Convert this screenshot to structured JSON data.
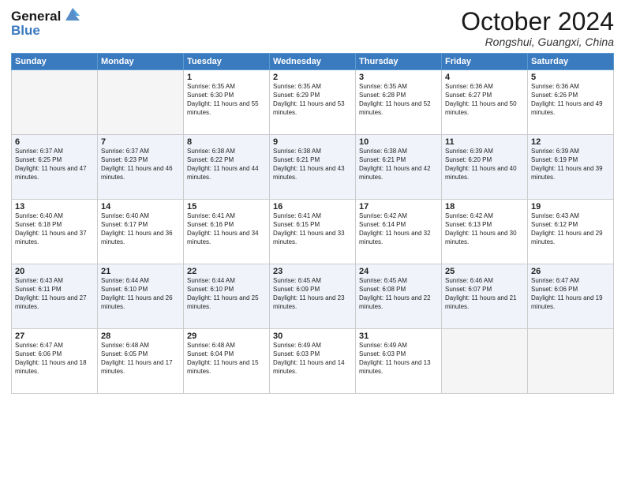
{
  "logo": {
    "line1": "General",
    "line2": "Blue"
  },
  "title": "October 2024",
  "location": "Rongshui, Guangxi, China",
  "weekdays": [
    "Sunday",
    "Monday",
    "Tuesday",
    "Wednesday",
    "Thursday",
    "Friday",
    "Saturday"
  ],
  "weeks": [
    [
      {
        "day": "",
        "sunrise": "",
        "sunset": "",
        "daylight": "",
        "empty": true
      },
      {
        "day": "",
        "sunrise": "",
        "sunset": "",
        "daylight": "",
        "empty": true
      },
      {
        "day": "1",
        "sunrise": "Sunrise: 6:35 AM",
        "sunset": "Sunset: 6:30 PM",
        "daylight": "Daylight: 11 hours and 55 minutes."
      },
      {
        "day": "2",
        "sunrise": "Sunrise: 6:35 AM",
        "sunset": "Sunset: 6:29 PM",
        "daylight": "Daylight: 11 hours and 53 minutes."
      },
      {
        "day": "3",
        "sunrise": "Sunrise: 6:35 AM",
        "sunset": "Sunset: 6:28 PM",
        "daylight": "Daylight: 11 hours and 52 minutes."
      },
      {
        "day": "4",
        "sunrise": "Sunrise: 6:36 AM",
        "sunset": "Sunset: 6:27 PM",
        "daylight": "Daylight: 11 hours and 50 minutes."
      },
      {
        "day": "5",
        "sunrise": "Sunrise: 6:36 AM",
        "sunset": "Sunset: 6:26 PM",
        "daylight": "Daylight: 11 hours and 49 minutes."
      }
    ],
    [
      {
        "day": "6",
        "sunrise": "Sunrise: 6:37 AM",
        "sunset": "Sunset: 6:25 PM",
        "daylight": "Daylight: 11 hours and 47 minutes."
      },
      {
        "day": "7",
        "sunrise": "Sunrise: 6:37 AM",
        "sunset": "Sunset: 6:23 PM",
        "daylight": "Daylight: 11 hours and 46 minutes."
      },
      {
        "day": "8",
        "sunrise": "Sunrise: 6:38 AM",
        "sunset": "Sunset: 6:22 PM",
        "daylight": "Daylight: 11 hours and 44 minutes."
      },
      {
        "day": "9",
        "sunrise": "Sunrise: 6:38 AM",
        "sunset": "Sunset: 6:21 PM",
        "daylight": "Daylight: 11 hours and 43 minutes."
      },
      {
        "day": "10",
        "sunrise": "Sunrise: 6:38 AM",
        "sunset": "Sunset: 6:21 PM",
        "daylight": "Daylight: 11 hours and 42 minutes."
      },
      {
        "day": "11",
        "sunrise": "Sunrise: 6:39 AM",
        "sunset": "Sunset: 6:20 PM",
        "daylight": "Daylight: 11 hours and 40 minutes."
      },
      {
        "day": "12",
        "sunrise": "Sunrise: 6:39 AM",
        "sunset": "Sunset: 6:19 PM",
        "daylight": "Daylight: 11 hours and 39 minutes."
      }
    ],
    [
      {
        "day": "13",
        "sunrise": "Sunrise: 6:40 AM",
        "sunset": "Sunset: 6:18 PM",
        "daylight": "Daylight: 11 hours and 37 minutes."
      },
      {
        "day": "14",
        "sunrise": "Sunrise: 6:40 AM",
        "sunset": "Sunset: 6:17 PM",
        "daylight": "Daylight: 11 hours and 36 minutes."
      },
      {
        "day": "15",
        "sunrise": "Sunrise: 6:41 AM",
        "sunset": "Sunset: 6:16 PM",
        "daylight": "Daylight: 11 hours and 34 minutes."
      },
      {
        "day": "16",
        "sunrise": "Sunrise: 6:41 AM",
        "sunset": "Sunset: 6:15 PM",
        "daylight": "Daylight: 11 hours and 33 minutes."
      },
      {
        "day": "17",
        "sunrise": "Sunrise: 6:42 AM",
        "sunset": "Sunset: 6:14 PM",
        "daylight": "Daylight: 11 hours and 32 minutes."
      },
      {
        "day": "18",
        "sunrise": "Sunrise: 6:42 AM",
        "sunset": "Sunset: 6:13 PM",
        "daylight": "Daylight: 11 hours and 30 minutes."
      },
      {
        "day": "19",
        "sunrise": "Sunrise: 6:43 AM",
        "sunset": "Sunset: 6:12 PM",
        "daylight": "Daylight: 11 hours and 29 minutes."
      }
    ],
    [
      {
        "day": "20",
        "sunrise": "Sunrise: 6:43 AM",
        "sunset": "Sunset: 6:11 PM",
        "daylight": "Daylight: 11 hours and 27 minutes."
      },
      {
        "day": "21",
        "sunrise": "Sunrise: 6:44 AM",
        "sunset": "Sunset: 6:10 PM",
        "daylight": "Daylight: 11 hours and 26 minutes."
      },
      {
        "day": "22",
        "sunrise": "Sunrise: 6:44 AM",
        "sunset": "Sunset: 6:10 PM",
        "daylight": "Daylight: 11 hours and 25 minutes."
      },
      {
        "day": "23",
        "sunrise": "Sunrise: 6:45 AM",
        "sunset": "Sunset: 6:09 PM",
        "daylight": "Daylight: 11 hours and 23 minutes."
      },
      {
        "day": "24",
        "sunrise": "Sunrise: 6:45 AM",
        "sunset": "Sunset: 6:08 PM",
        "daylight": "Daylight: 11 hours and 22 minutes."
      },
      {
        "day": "25",
        "sunrise": "Sunrise: 6:46 AM",
        "sunset": "Sunset: 6:07 PM",
        "daylight": "Daylight: 11 hours and 21 minutes."
      },
      {
        "day": "26",
        "sunrise": "Sunrise: 6:47 AM",
        "sunset": "Sunset: 6:06 PM",
        "daylight": "Daylight: 11 hours and 19 minutes."
      }
    ],
    [
      {
        "day": "27",
        "sunrise": "Sunrise: 6:47 AM",
        "sunset": "Sunset: 6:06 PM",
        "daylight": "Daylight: 11 hours and 18 minutes."
      },
      {
        "day": "28",
        "sunrise": "Sunrise: 6:48 AM",
        "sunset": "Sunset: 6:05 PM",
        "daylight": "Daylight: 11 hours and 17 minutes."
      },
      {
        "day": "29",
        "sunrise": "Sunrise: 6:48 AM",
        "sunset": "Sunset: 6:04 PM",
        "daylight": "Daylight: 11 hours and 15 minutes."
      },
      {
        "day": "30",
        "sunrise": "Sunrise: 6:49 AM",
        "sunset": "Sunset: 6:03 PM",
        "daylight": "Daylight: 11 hours and 14 minutes."
      },
      {
        "day": "31",
        "sunrise": "Sunrise: 6:49 AM",
        "sunset": "Sunset: 6:03 PM",
        "daylight": "Daylight: 11 hours and 13 minutes."
      },
      {
        "day": "",
        "sunrise": "",
        "sunset": "",
        "daylight": "",
        "empty": true
      },
      {
        "day": "",
        "sunrise": "",
        "sunset": "",
        "daylight": "",
        "empty": true
      }
    ]
  ]
}
